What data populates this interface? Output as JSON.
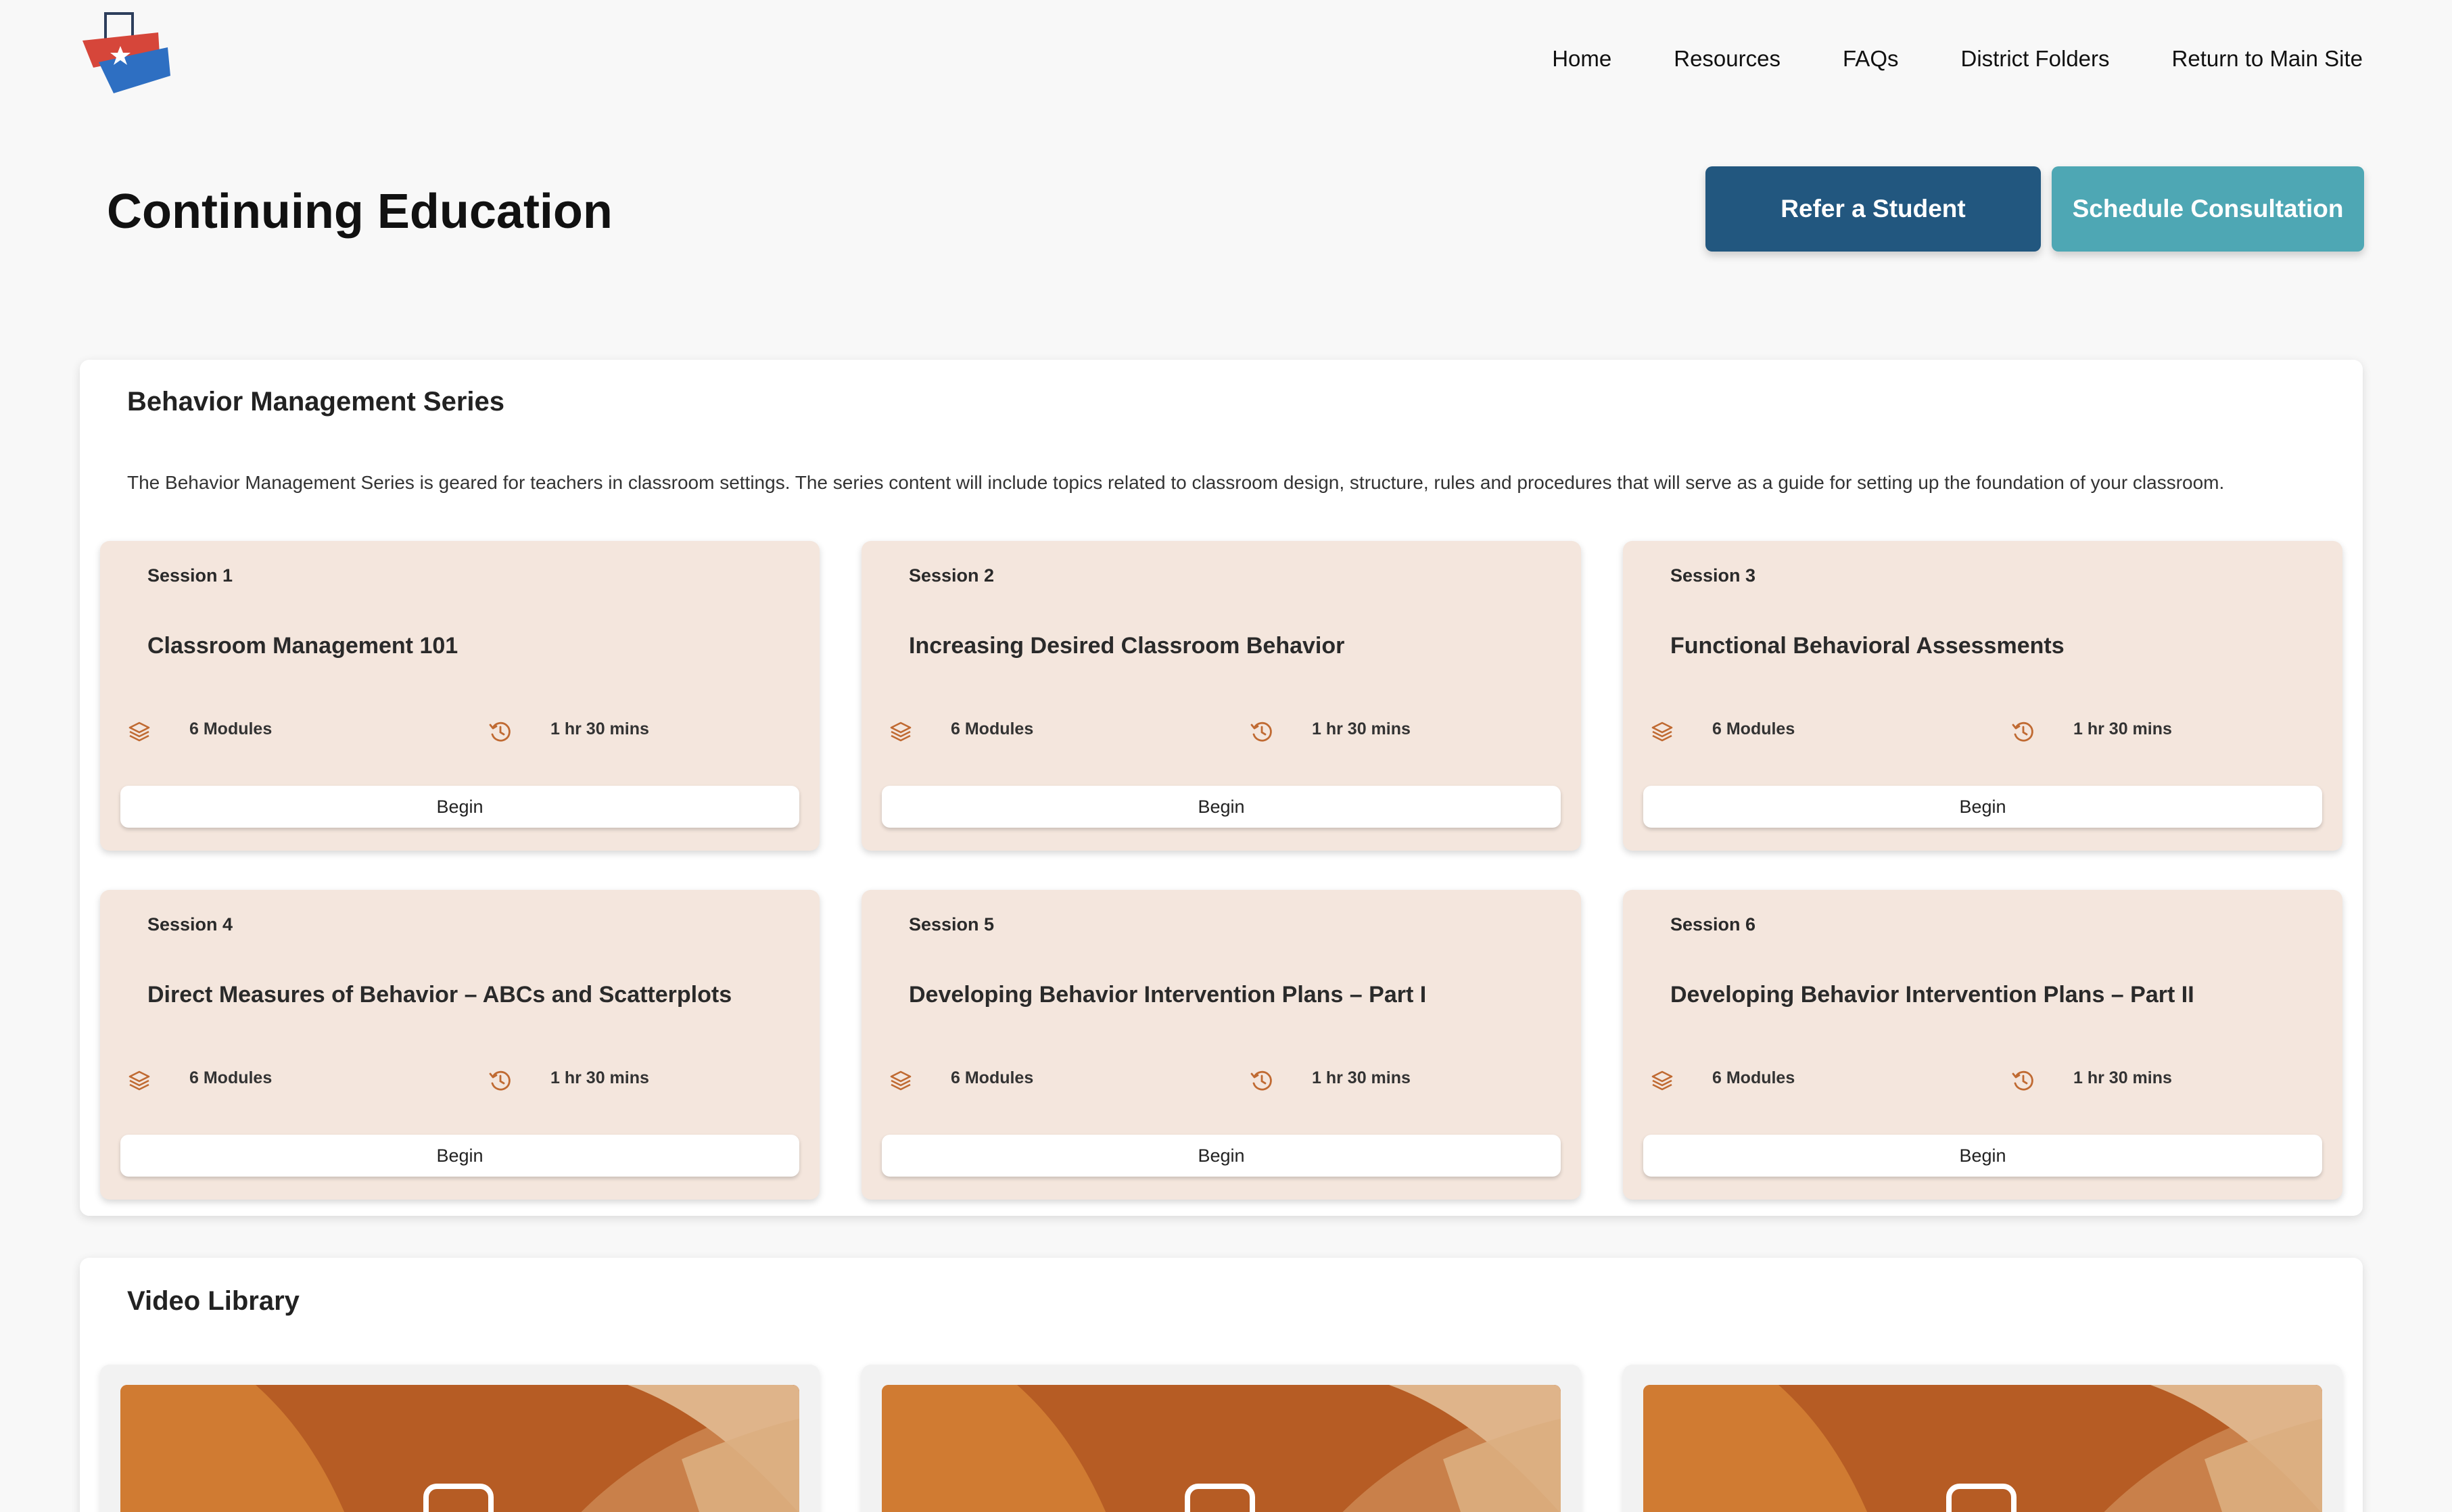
{
  "header": {
    "nav": [
      "Home",
      "Resources",
      "FAQs",
      "District Folders",
      "Return to Main Site"
    ]
  },
  "page": {
    "title": "Continuing Education",
    "refer_label": "Refer a Student",
    "consult_label": "Schedule Consultation"
  },
  "behavior": {
    "title": "Behavior Management Series",
    "description": "The Behavior Management Series is geared for teachers in classroom settings. The series content will include topics related to classroom design, structure, rules and procedures that will serve as a guide for setting up the foundation of your classroom.",
    "sessions": [
      {
        "label": "Session 1",
        "title": "Classroom Management 101",
        "modules": "6 Modules",
        "duration": "1 hr 30 mins",
        "button": "Begin"
      },
      {
        "label": "Session 2",
        "title": "Increasing Desired Classroom Behavior",
        "modules": "6 Modules",
        "duration": "1 hr 30 mins",
        "button": "Begin"
      },
      {
        "label": "Session 3",
        "title": "Functional Behavioral Assessments",
        "modules": "6 Modules",
        "duration": "1 hr 30 mins",
        "button": "Begin"
      },
      {
        "label": "Session 4",
        "title": "Direct Measures of Behavior – ABCs and Scatterplots",
        "modules": "6 Modules",
        "duration": "1 hr 30 mins",
        "button": "Begin"
      },
      {
        "label": "Session 5",
        "title": "Developing Behavior Intervention Plans – Part I",
        "modules": "6 Modules",
        "duration": "1 hr 30 mins",
        "button": "Begin"
      },
      {
        "label": "Session 6",
        "title": "Developing Behavior Intervention Plans – Part II",
        "modules": "6 Modules",
        "duration": "1 hr 30 mins",
        "button": "Begin"
      }
    ]
  },
  "video": {
    "title": "Video Library"
  },
  "colors": {
    "primary": "#22577f",
    "secondary": "#4ea7b4",
    "card_bg": "#f4e6dd",
    "icon": "#c06a32",
    "thumb_orange": "#d07b32"
  },
  "icons": {
    "modules": "layers-icon",
    "duration": "clock-history-icon",
    "video": "play-icon"
  }
}
